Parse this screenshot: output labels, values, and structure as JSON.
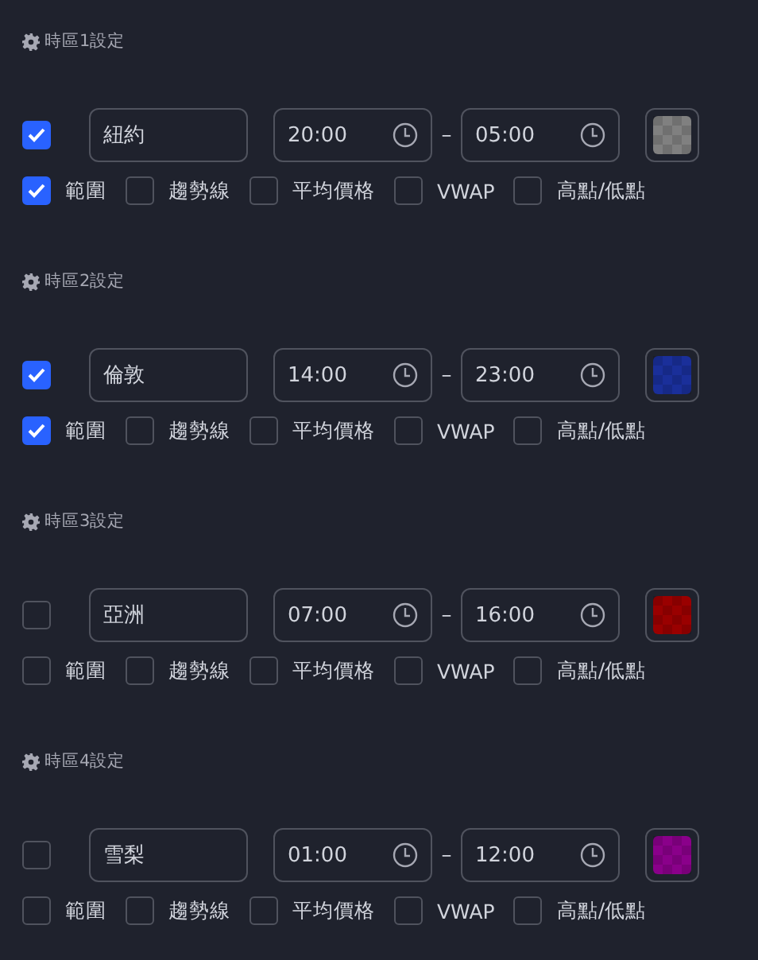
{
  "sessions": [
    {
      "title": "時區1設定",
      "enabled": true,
      "name": "紐約",
      "start": "20:00",
      "separator": "–",
      "end": "05:00",
      "color": "#808080",
      "options": [
        {
          "label": "範圍",
          "checked": true
        },
        {
          "label": "趨勢線",
          "checked": false
        },
        {
          "label": "平均價格",
          "checked": false
        },
        {
          "label": "VWAP",
          "checked": false
        },
        {
          "label": "高點/低點",
          "checked": false
        }
      ]
    },
    {
      "title": "時區2設定",
      "enabled": true,
      "name": "倫敦",
      "start": "14:00",
      "separator": "–",
      "end": "23:00",
      "color": "#1a2f9a",
      "options": [
        {
          "label": "範圍",
          "checked": true
        },
        {
          "label": "趨勢線",
          "checked": false
        },
        {
          "label": "平均價格",
          "checked": false
        },
        {
          "label": "VWAP",
          "checked": false
        },
        {
          "label": "高點/低點",
          "checked": false
        }
      ]
    },
    {
      "title": "時區3設定",
      "enabled": false,
      "name": "亞洲",
      "start": "07:00",
      "separator": "–",
      "end": "16:00",
      "color": "#9a0000",
      "options": [
        {
          "label": "範圍",
          "checked": false
        },
        {
          "label": "趨勢線",
          "checked": false
        },
        {
          "label": "平均價格",
          "checked": false
        },
        {
          "label": "VWAP",
          "checked": false
        },
        {
          "label": "高點/低點",
          "checked": false
        }
      ]
    },
    {
      "title": "時區4設定",
      "enabled": false,
      "name": "雪梨",
      "start": "01:00",
      "separator": "–",
      "end": "12:00",
      "color": "#8a008a",
      "options": [
        {
          "label": "範圍",
          "checked": false
        },
        {
          "label": "趨勢線",
          "checked": false
        },
        {
          "label": "平均價格",
          "checked": false
        },
        {
          "label": "VWAP",
          "checked": false
        },
        {
          "label": "高點/低點",
          "checked": false
        }
      ]
    }
  ]
}
